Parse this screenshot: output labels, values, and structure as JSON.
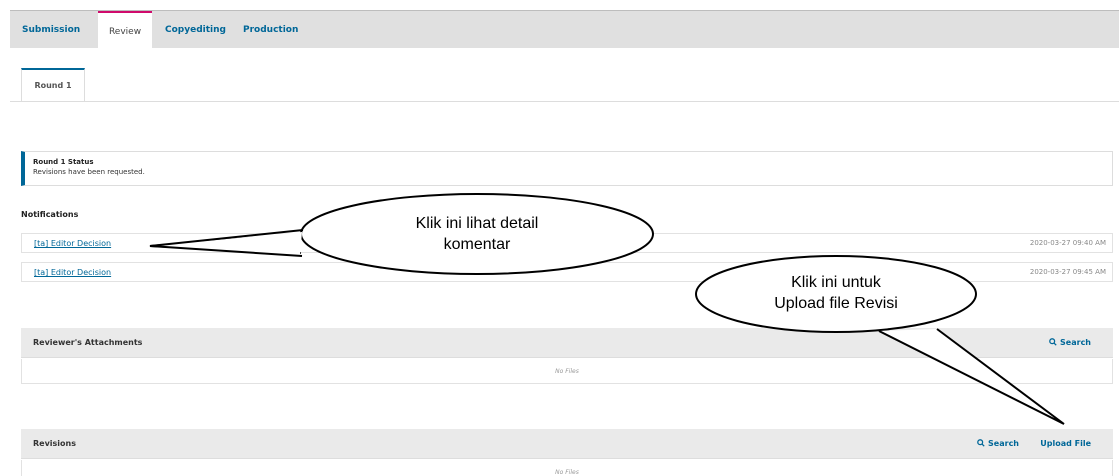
{
  "tabs": [
    "Submission",
    "Review",
    "Copyediting",
    "Production"
  ],
  "round_tab": "Round 1",
  "status": {
    "title": "Round 1 Status",
    "text": "Revisions have been requested."
  },
  "notifications": {
    "heading": "Notifications",
    "items": [
      {
        "label": "[ta] Editor Decision",
        "date": "2020-03-27 09:40 AM"
      },
      {
        "label": "[ta] Editor Decision",
        "date": "2020-03-27 09:45 AM"
      }
    ]
  },
  "reviewer_attachments": {
    "title": "Reviewer's Attachments",
    "search": "Search",
    "empty": "No Files"
  },
  "revisions": {
    "title": "Revisions",
    "search": "Search",
    "upload": "Upload File",
    "empty": "No Files"
  },
  "callouts": {
    "left": [
      "Klik ini lihat detail",
      "komentar"
    ],
    "right": [
      "Klik ini untuk",
      "Upload file Revisi"
    ]
  },
  "colors": {
    "link": "#006798",
    "active_tab_border": "#d00a6c"
  }
}
